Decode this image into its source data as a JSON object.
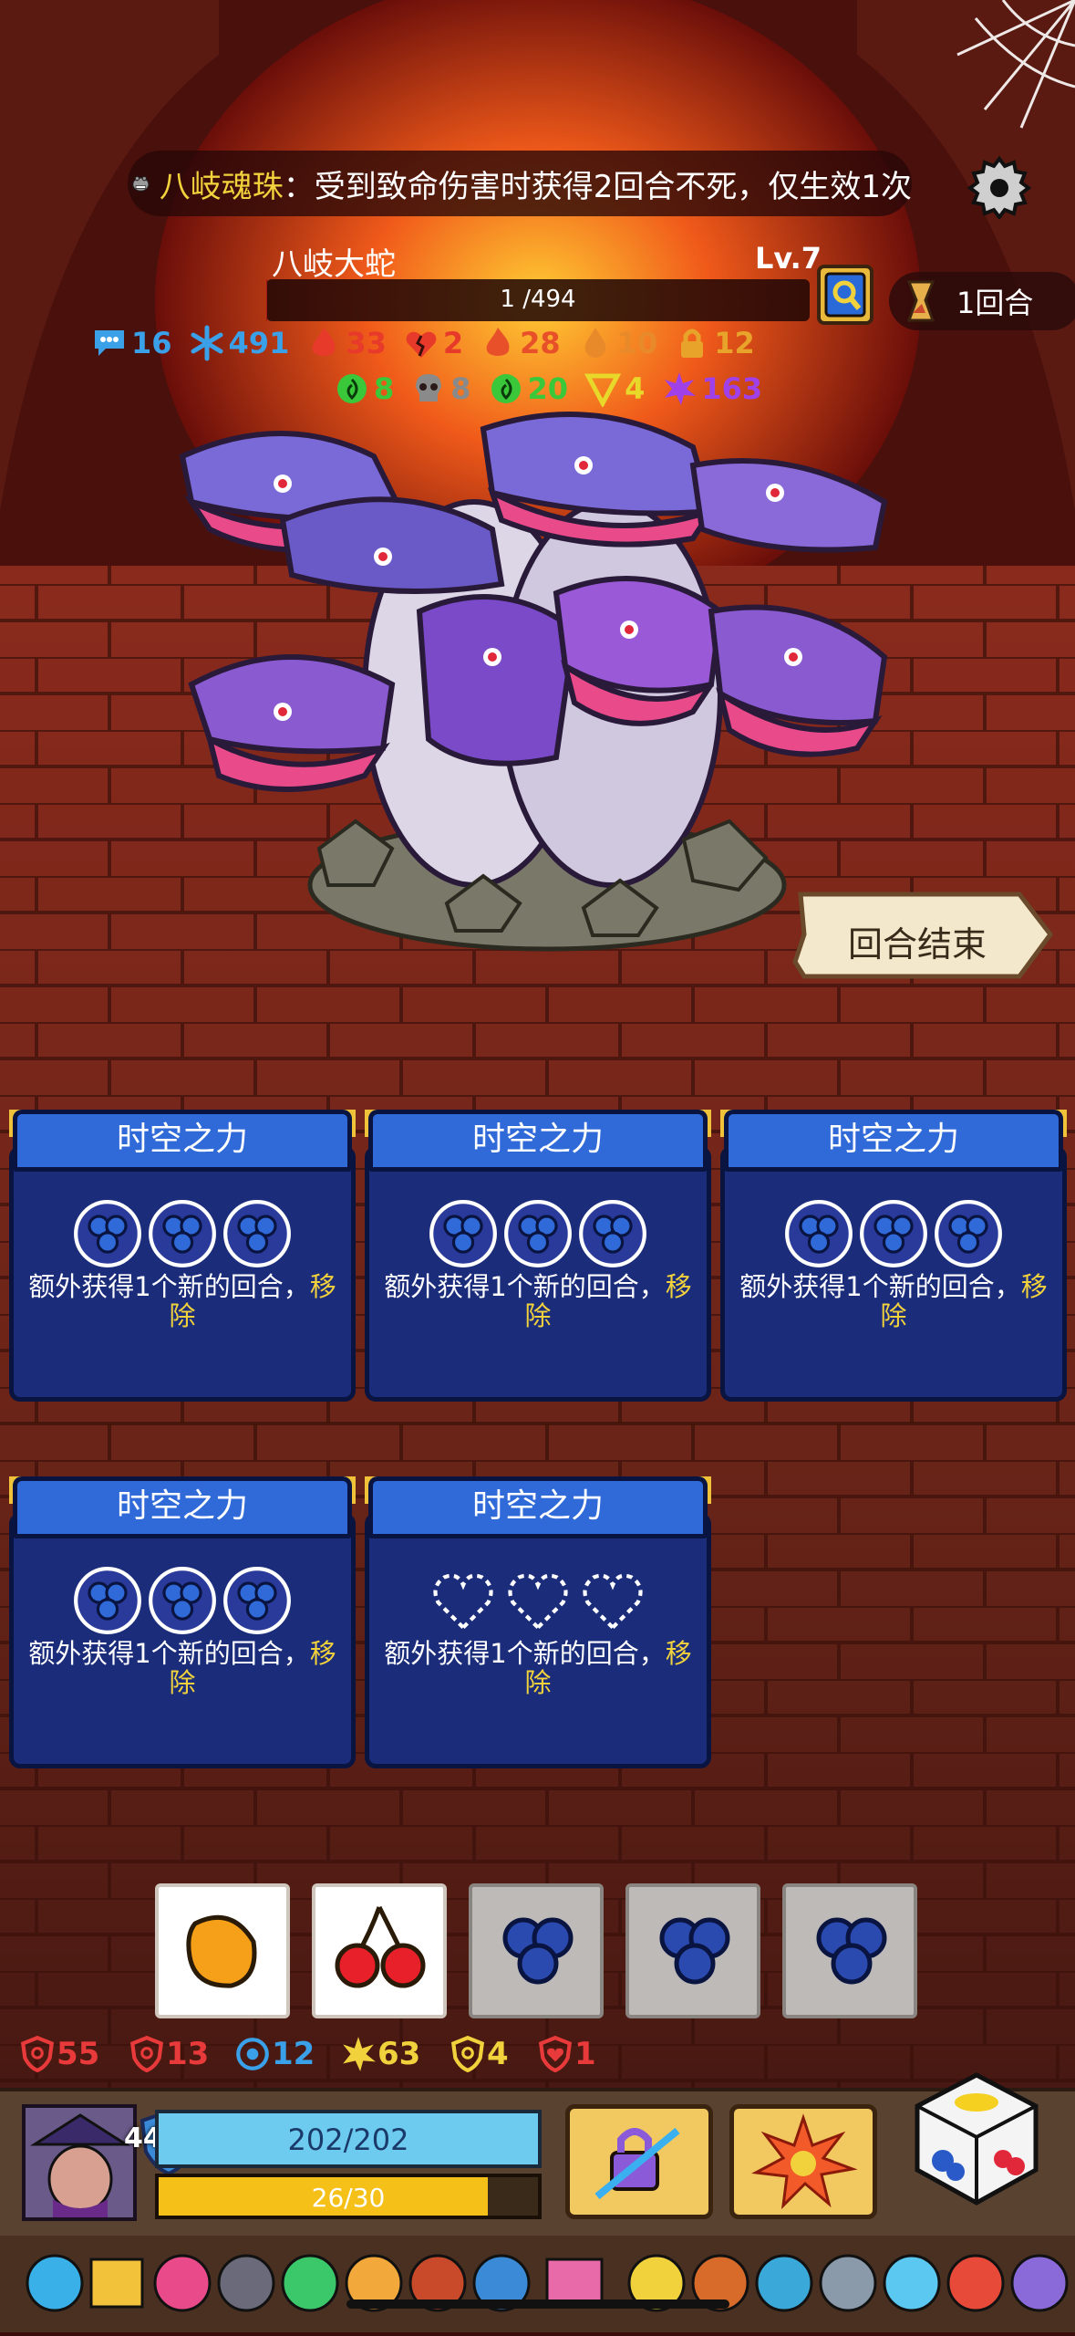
{
  "relic": {
    "name": "八岐魂珠",
    "separator": "：",
    "desc": "受到致命伤害时获得2回合不死，仅生效1次"
  },
  "boss": {
    "name": "八岐大蛇",
    "level": "Lv.7",
    "hp_text": "1 /494",
    "hp_fraction": 0.002
  },
  "turn": {
    "label": "1回合"
  },
  "boss_status_row1": [
    {
      "icon": "speech-bubble-icon",
      "value": "16",
      "color": "#3aa0e8"
    },
    {
      "icon": "snowflake-icon",
      "value": "491",
      "color": "#3aa0e8"
    },
    {
      "icon": "flame-icon",
      "value": "33",
      "color": "#e83a2a"
    },
    {
      "icon": "broken-heart-icon",
      "value": "2",
      "color": "#e83a2a"
    },
    {
      "icon": "fire-icon",
      "value": "28",
      "color": "#e8502a"
    },
    {
      "icon": "droplet-icon",
      "value": "10",
      "color": "#e88a2a"
    },
    {
      "icon": "padlock-icon",
      "value": "12",
      "color": "#e8a42a"
    }
  ],
  "boss_status_row2": [
    {
      "icon": "thorn-icon",
      "value": "8",
      "color": "#3ac83a"
    },
    {
      "icon": "skull-icon",
      "value": "8",
      "color": "#8a8a8a"
    },
    {
      "icon": "poison-swirl-icon",
      "value": "20",
      "color": "#3ac83a"
    },
    {
      "icon": "triangle-icon",
      "value": "4",
      "color": "#e8d82a"
    },
    {
      "icon": "splat-icon",
      "value": "163",
      "color": "#a040e8"
    }
  ],
  "end_turn_label": "回合结束",
  "cards": [
    {
      "title": "时空之力",
      "desc": "额外获得1个新的回合，",
      "keyword": "移除",
      "slots": "filled"
    },
    {
      "title": "时空之力",
      "desc": "额外获得1个新的回合，",
      "keyword": "移除",
      "slots": "filled"
    },
    {
      "title": "时空之力",
      "desc": "额外获得1个新的回合，",
      "keyword": "移除",
      "slots": "filled"
    },
    {
      "title": "时空之力",
      "desc": "额外获得1个新的回合，",
      "keyword": "移除",
      "slots": "filled"
    },
    {
      "title": "时空之力",
      "desc": "额外获得1个新的回合，",
      "keyword": "移除",
      "slots": "empty"
    }
  ],
  "dice": [
    {
      "face": "orange-fruit-icon",
      "style": "white"
    },
    {
      "face": "cherry-icon",
      "style": "white"
    },
    {
      "face": "blueberry-icon",
      "style": "gray"
    },
    {
      "face": "blueberry-icon",
      "style": "gray"
    },
    {
      "face": "blueberry-icon",
      "style": "gray"
    }
  ],
  "player_stats": [
    {
      "icon": "swirl-shield-icon",
      "value": "55",
      "color": "#e83a3a"
    },
    {
      "icon": "cracked-shield-icon",
      "value": "13",
      "color": "#e83a3a"
    },
    {
      "icon": "target-icon",
      "value": "12",
      "color": "#3aa0e8"
    },
    {
      "icon": "star-burst-icon",
      "value": "63",
      "color": "#f2d23c"
    },
    {
      "icon": "gold-shield-icon",
      "value": "4",
      "color": "#f2d23c"
    },
    {
      "icon": "heart-shield-icon",
      "value": "1",
      "color": "#e83a3a"
    }
  ],
  "player": {
    "shield": "44934",
    "hp_text": "202/202",
    "mana_text": "26/30",
    "mana_fraction": 0.867
  },
  "colors": {
    "card_blue": "#1a2c7a",
    "card_header": "#2f6ad8",
    "gold": "#f2d23c"
  }
}
